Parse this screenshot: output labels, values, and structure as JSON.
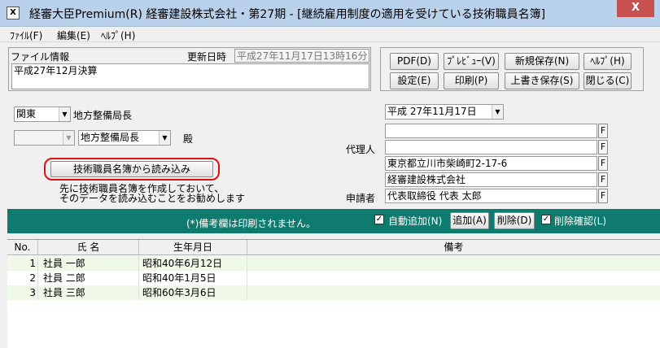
{
  "window": {
    "title": "経審大臣Premium(R)  経審建設株式会社・第27期 - [継続雇用制度の適用を受けている技術職員名簿]",
    "app_icon": "X",
    "close_label": "X"
  },
  "menu": {
    "file": "ﾌｧｲﾙ(F)",
    "edit": "編集(E)",
    "help": "ﾍﾙﾌﾟ(H)"
  },
  "file_info": {
    "label": "ファイル情報",
    "updated_label": "更新日時",
    "updated_value": "平成27年11月17日13時16分",
    "memo": "平成27年12月決算"
  },
  "toolbar": {
    "pdf": "PDF(D)",
    "preview": "ﾌﾟﾚﾋﾞｭｰ(V)",
    "new_save": "新規保存(N)",
    "help": "ﾍﾙﾌﾟ(H)",
    "settings": "設定(E)",
    "print": "印刷(P)",
    "overwrite_save": "上書き保存(S)",
    "close": "閉じる(C)"
  },
  "address": {
    "bureau_select": "関東",
    "bureau_suffix": "地方整備局長",
    "sub_select": "",
    "sub_select2": "地方整備局長",
    "honorific": "殿"
  },
  "date_select": "平成 27年11月17日",
  "agent": {
    "label": "代理人",
    "line1": "",
    "line2": "",
    "f_label": "F"
  },
  "applicant": {
    "label": "申請者",
    "address": "東京都立川市柴崎町2-17-6",
    "company": "経審建設株式会社",
    "representative": "代表取締役    代表  太郎"
  },
  "import": {
    "button": "技術職員名簿から読み込み",
    "note_line1": "先に技術職員名簿を作成しておいて、",
    "note_line2": "そのデータを読み込むことをお勧めします"
  },
  "bar": {
    "note": "(*)備考欄は印刷されません。",
    "auto_add": "自動追加(N)",
    "add": "追加(A)",
    "delete": "削除(D)",
    "delete_confirm": "削除確認(L)"
  },
  "table": {
    "headers": [
      "No.",
      "氏  名",
      "生年月日",
      "備考"
    ],
    "rows": [
      {
        "no": "1",
        "name": "社員  一郎",
        "birth": "昭和40年6月12日",
        "note": ""
      },
      {
        "no": "2",
        "name": "社員  二郎",
        "birth": "昭和40年1月5日",
        "note": ""
      },
      {
        "no": "3",
        "name": "社員  三郎",
        "birth": "昭和60年3月6日",
        "note": ""
      }
    ]
  },
  "colors": {
    "teal_bar": "#0f7b6f",
    "close_red": "#c75050",
    "titlebar": "#b9d1ea",
    "row_alt": "#f0f8e8",
    "highlight_ring": "#e01010"
  }
}
